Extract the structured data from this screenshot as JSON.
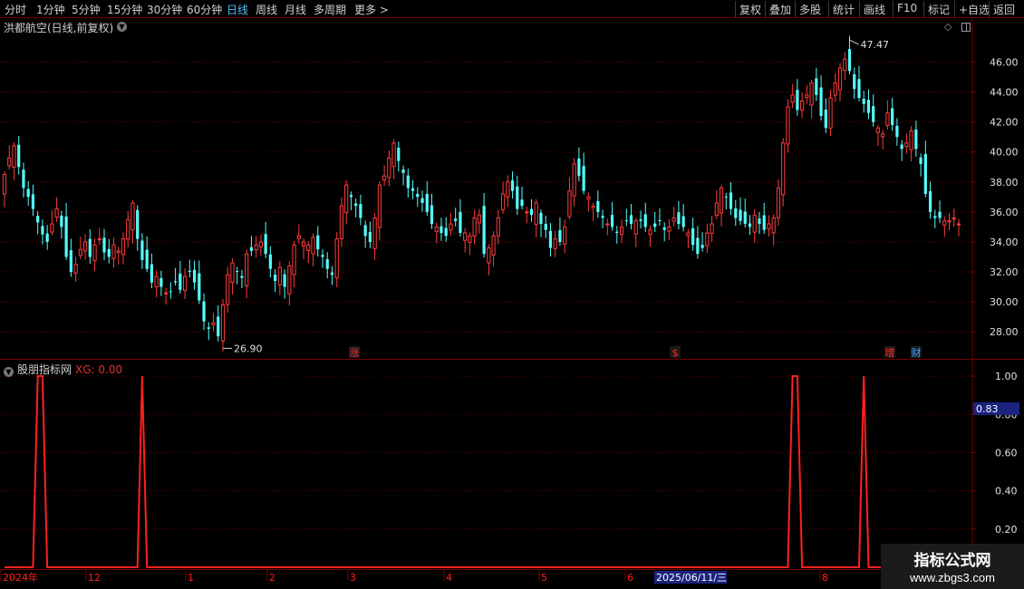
{
  "toolbar": {
    "left": [
      "分时",
      "1分钟",
      "5分钟",
      "15分钟",
      "30分钟",
      "60分钟",
      "日线",
      "周线",
      "月线",
      "多周期",
      "更多 >"
    ],
    "active": "日线",
    "right": [
      "复权",
      "叠加",
      "多股",
      "统计",
      "画线",
      "F10",
      "标记",
      "+自选",
      "返回"
    ]
  },
  "main_chart": {
    "title": "洪都航空(日线,前复权)",
    "high_label": "47.47",
    "low_label": "26.90",
    "event_markers": [
      {
        "text": "涨",
        "color": "#ff2a2a"
      },
      {
        "text": "$",
        "color": "#ff2a2a"
      },
      {
        "text": "增",
        "color": "#ff2a2a"
      },
      {
        "text": "财",
        "color": "#40a8ff"
      }
    ]
  },
  "sub_chart": {
    "title": "股朋指标网",
    "xg_label": "XG: 0.00",
    "cursor_value": "0.83"
  },
  "x_axis": {
    "labels": [
      "2024年",
      "12",
      "1",
      "2",
      "3",
      "4",
      "5",
      "6",
      "2025/06/11/三",
      "8"
    ],
    "highlight": "2025/06/11/三"
  },
  "watermark": {
    "title": "指标公式网",
    "url": "www.zbgs3.com"
  },
  "colors": {
    "up": "#ff3b3b",
    "down": "#54ffff",
    "grid": "#7a0000",
    "axis_text": "#e0e0e0",
    "indicator": "#ff2020"
  },
  "chart_data": [
    {
      "type": "candlestick",
      "title": "洪都航空(日线,前复权)",
      "ylim": [
        26.2,
        47.9
      ],
      "y_ticks": [
        28.0,
        30.0,
        32.0,
        34.0,
        36.0,
        38.0,
        40.0,
        42.0,
        44.0,
        46.0
      ],
      "y_tick_labels": [
        "28.00",
        "30.00",
        "32.00",
        "34.00",
        "36.00",
        "38.00",
        "40.00",
        "42.00",
        "44.00",
        "46.00"
      ],
      "annotations": [
        {
          "label": "47.47",
          "value": 47.47
        },
        {
          "label": "26.90",
          "value": 26.9
        }
      ],
      "closes": [
        38.5,
        39.6,
        40.4,
        39.0,
        37.6,
        37.0,
        36.2,
        35.3,
        34.5,
        34.0,
        35.2,
        36.2,
        35.0,
        33.0,
        32.0,
        32.5,
        33.5,
        34.0,
        33.0,
        33.8,
        34.2,
        33.3,
        33.0,
        33.8,
        33.4,
        34.2,
        35.5,
        36.6,
        34.2,
        32.8,
        32.2,
        31.3,
        31.7,
        31.0,
        30.6,
        30.7,
        31.3,
        30.8,
        31.7,
        32.0,
        31.3,
        30.1,
        28.7,
        28.2,
        28.6,
        27.7,
        29.8,
        31.8,
        32.6,
        32.0,
        31.6,
        33.2,
        33.4,
        33.8,
        34.0,
        33.2,
        32.2,
        31.4,
        32.3,
        31.0,
        32.4,
        33.8,
        34.4,
        34.0,
        33.8,
        34.3,
        33.5,
        33.0,
        32.2,
        31.8,
        34.2,
        36.4,
        37.8,
        37.0,
        36.4,
        35.6,
        34.4,
        34.0,
        35.6,
        37.8,
        38.4,
        39.6,
        40.6,
        39.4,
        38.6,
        37.6,
        37.4,
        37.0,
        36.6,
        36.0,
        35.2,
        35.0,
        34.6,
        34.4,
        35.2,
        35.4,
        34.6,
        34.6,
        34.4,
        35.6,
        35.8,
        33.2,
        33.6,
        34.4,
        35.6,
        37.2,
        38.0,
        37.4,
        36.2,
        36.4,
        36.0,
        35.8,
        36.6,
        35.2,
        34.8,
        33.6,
        34.2,
        34.0,
        35.0,
        37.4,
        39.2,
        38.4,
        37.4,
        37.0,
        36.4,
        36.0,
        35.6,
        35.2,
        35.0,
        34.6,
        35.0,
        35.4,
        35.2,
        35.4,
        35.4,
        35.0,
        34.8,
        35.0,
        35.4,
        34.8,
        35.0,
        35.6,
        35.2,
        35.0,
        34.6,
        33.8,
        33.2,
        33.6,
        34.6,
        35.2,
        36.6,
        37.6,
        37.0,
        36.2,
        35.6,
        35.4,
        35.2,
        35.0,
        35.8,
        35.2,
        34.8,
        35.2,
        35.6,
        37.6,
        40.6,
        43.0,
        43.8,
        42.8,
        43.4,
        43.8,
        44.6,
        43.8,
        42.4,
        41.6,
        43.6,
        44.6,
        45.6,
        46.2,
        45.4,
        44.2,
        43.6,
        43.2,
        42.6,
        42.0,
        41.6,
        41.2,
        42.6,
        41.8,
        41.0,
        40.2,
        40.6,
        41.4,
        40.2,
        39.2,
        37.2,
        36.0,
        35.6,
        35.6,
        35.4,
        35.4,
        35.6,
        35.2
      ]
    },
    {
      "type": "line",
      "title": "股朋指标网",
      "ylim": [
        0,
        1.1
      ],
      "y_ticks": [
        0.2,
        0.4,
        0.6,
        0.8,
        1.0
      ],
      "y_tick_labels": [
        "0.20",
        "0.40",
        "0.60",
        "0.80",
        "1.00"
      ],
      "series": [
        {
          "name": "XG",
          "x": [
            0,
            6,
            7,
            8,
            9,
            28,
            29,
            30,
            165,
            166,
            167,
            168,
            180,
            181,
            182,
            200
          ],
          "values": [
            0,
            0,
            1,
            1,
            0,
            0,
            1,
            0,
            0,
            1,
            1,
            0,
            0,
            1,
            0,
            0
          ]
        }
      ]
    }
  ]
}
